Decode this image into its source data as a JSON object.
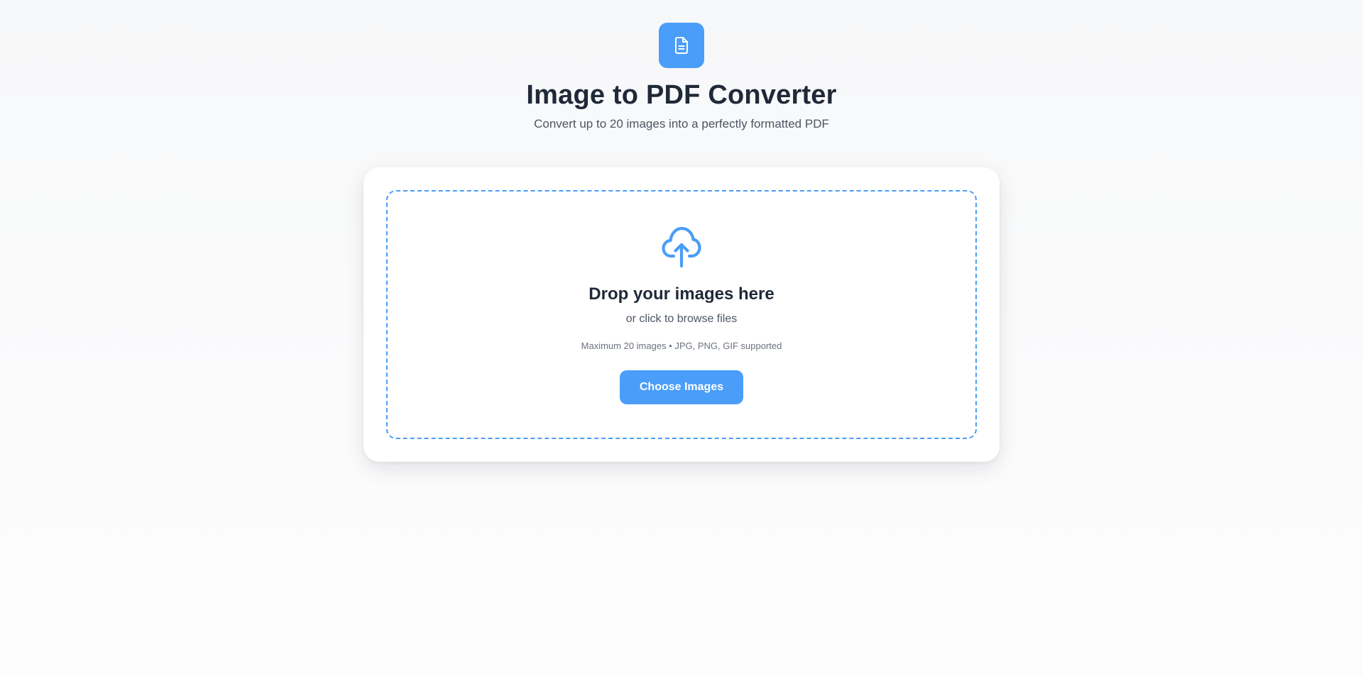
{
  "header": {
    "logo_icon": "document-icon",
    "title": "Image to PDF Converter",
    "subtitle": "Convert up to 20 images into a perfectly formatted PDF"
  },
  "dropzone": {
    "icon": "cloud-upload-icon",
    "title": "Drop your images here",
    "subtitle": "or click to browse files",
    "note": "Maximum 20 images • JPG, PNG, GIF supported",
    "button_label": "Choose Images"
  },
  "colors": {
    "accent": "#4a9df8",
    "text_primary": "#1f2937",
    "text_secondary": "#4b5563",
    "text_muted": "#6b7280",
    "background": "#f8f9fa",
    "card": "#ffffff"
  }
}
